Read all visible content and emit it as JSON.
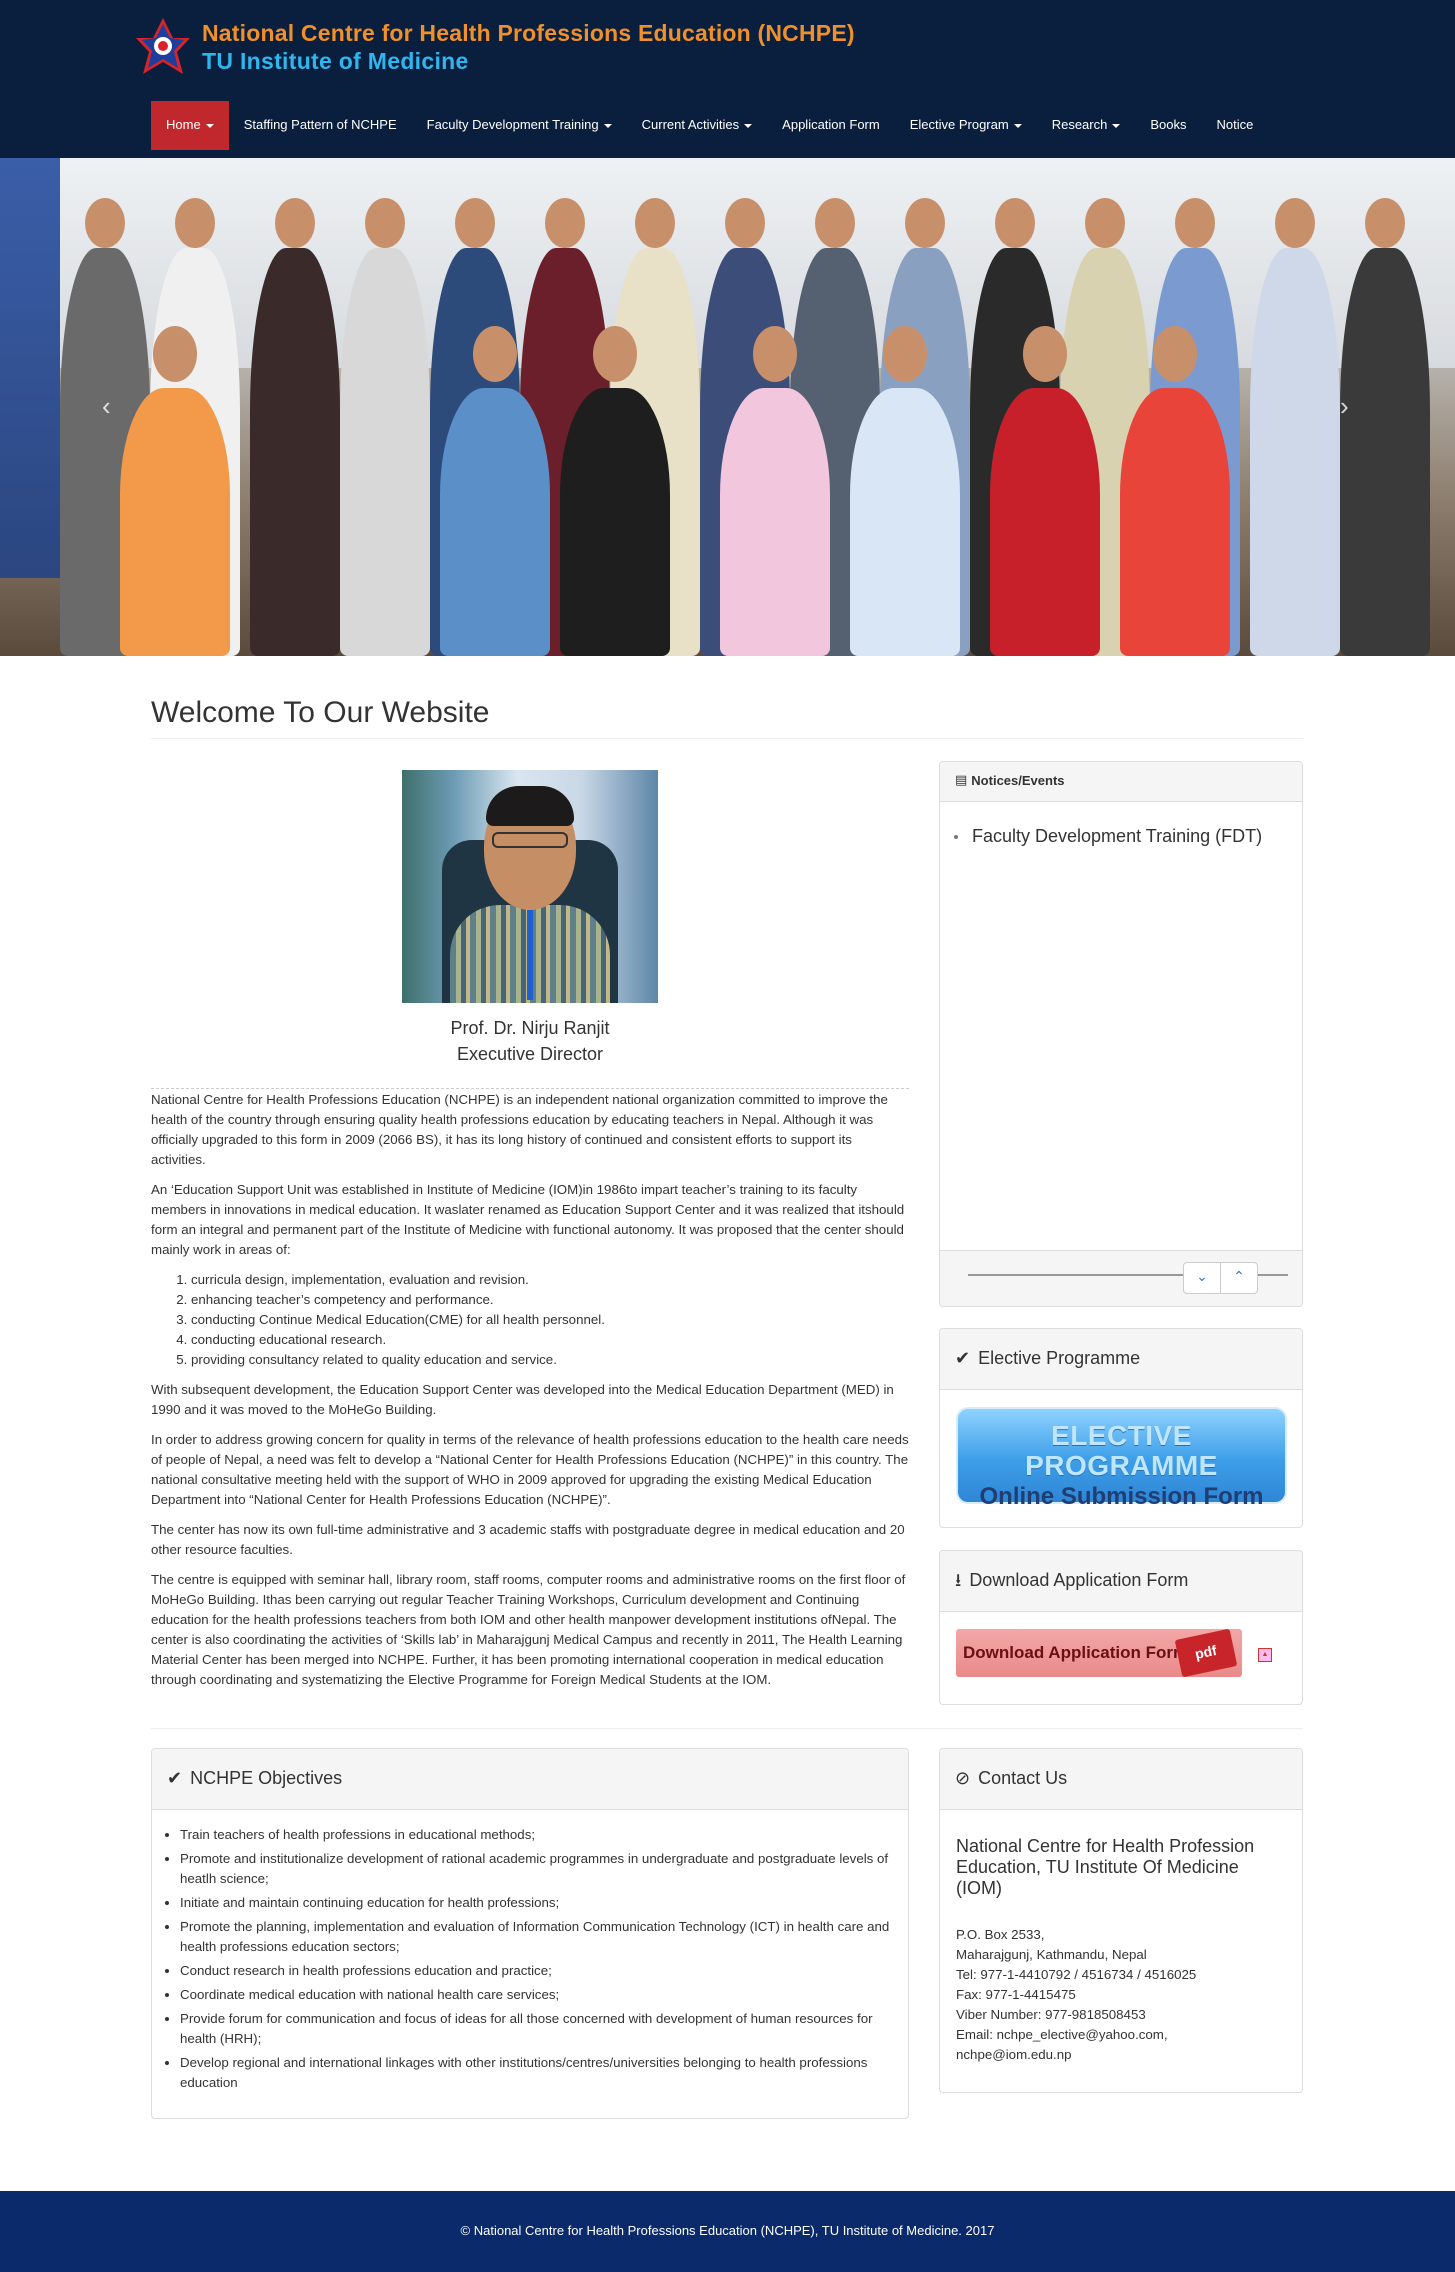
{
  "header": {
    "title_line1": "National Centre for Health Professions Education (NCHPE)",
    "title_line2": "TU Institute of Medicine",
    "logo_icon": "star-emblem-icon",
    "colors": {
      "background": "#0a1f3d",
      "title1": "#f0902a",
      "title2": "#2fb6ee",
      "active_nav": "#c0282d"
    }
  },
  "nav": {
    "items": [
      {
        "label": "Home",
        "dropdown": true,
        "active": true
      },
      {
        "label": "Staffing Pattern of NCHPE",
        "dropdown": false
      },
      {
        "label": "Faculty Development Training",
        "dropdown": true
      },
      {
        "label": "Current Activities",
        "dropdown": true
      },
      {
        "label": "Application Form",
        "dropdown": false
      },
      {
        "label": "Elective Program",
        "dropdown": true
      },
      {
        "label": "Research",
        "dropdown": true
      },
      {
        "label": "Books",
        "dropdown": false
      },
      {
        "label": "Notice",
        "dropdown": false
      }
    ]
  },
  "carousel": {
    "prev": "‹",
    "next": "›"
  },
  "welcome": {
    "heading": "Welcome To Our Website"
  },
  "director": {
    "name": "Prof. Dr. Nirju Ranjit",
    "title": "Executive Director"
  },
  "about": {
    "p1": "National Centre for Health Professions Education (NCHPE) is an independent national organization committed to improve the health of the country through ensuring quality health professions education by educating teachers in Nepal. Although it was officially upgraded to this form in 2009 (2066 BS), it has its long history of continued and consistent efforts to support its activities.",
    "p2": "An ‘Education Support Unit was established in Institute of Medicine (IOM)in 1986to impart teacher’s training to its faculty members in innovations in medical education. It waslater renamed as Education Support Center and it was realized that itshould form an integral and permanent part of the Institute of Medicine with functional autonomy. It was proposed that the center should mainly work in areas of:",
    "areas": [
      "curricula design, implementation, evaluation and revision.",
      "enhancing teacher’s competency and performance.",
      "conducting Continue Medical Education(CME) for all health personnel.",
      "conducting educational research.",
      "providing consultancy related to quality education and service."
    ],
    "p3": "With subsequent development, the Education Support Center was developed into the Medical Education Department (MED) in 1990 and it was moved to the MoHeGo Building.",
    "p4": "In order to address growing concern for quality in terms of the relevance of health professions education to the health care needs of people of Nepal, a need was felt to develop a “National Center for Health Professions Education (NCHPE)” in this country. The national consultative meeting held with the support of WHO in 2009 approved for upgrading the existing Medical Education Department into “National Center for Health Professions Education (NCHPE)”.",
    "p5": "The center has now its own full-time  administrative and 3 academic staffs with postgraduate degree in medical education and 20 other resource faculties.",
    "p6": "The centre is equipped with seminar hall, library room, staff rooms, computer rooms and administrative rooms on the first floor of MoHeGo Building. Ithas been carrying out regular Teacher Training Workshops, Curriculum development and Continuing education for the health professions teachers from both IOM and other health manpower development institutions ofNepal. The center is also coordinating the activities of ‘Skills lab’ in Maharajgunj Medical Campus and recently in 2011, The Health Learning Material Center has been merged into NCHPE. Further, it has been promoting international cooperation in medical education through coordinating and systematizing the Elective Programme for Foreign Medical Students at the IOM."
  },
  "notices": {
    "heading": "Notices/Events",
    "items": [
      "Faculty Development Training (FDT)"
    ]
  },
  "elective": {
    "heading": "Elective Programme",
    "banner_line1": "ELECTIVE PROGRAMME",
    "banner_line2": "Online Submission Form"
  },
  "download": {
    "heading": "Download Application Form",
    "button_text": "Download Application Form",
    "pdf_label": "pdf"
  },
  "objectives": {
    "heading": "NCHPE Objectives",
    "items": [
      "Train teachers of health professions in educational methods;",
      "Promote and institutionalize development of rational academic programmes in undergraduate and postgraduate levels of heatlh science;",
      "Initiate and maintain continuing education for health professions;",
      "Promote the planning, implementation and evaluation of Information Communication Technology (ICT) in health care and health professions education sectors;",
      "Conduct research in health professions education and practice;",
      "Coordinate medical education with national health care services;",
      "Provide forum for communication and focus of ideas for all those concerned with development of human resources for health (HRH);",
      "Develop regional and international linkages with other institutions/centres/universities belonging to health professions education"
    ]
  },
  "contact": {
    "heading": "Contact Us",
    "org": "National Centre for Health Profession Education, TU Institute Of Medicine (IOM)",
    "lines": [
      "P.O. Box 2533,",
      "Maharajgunj, Kathmandu, Nepal",
      "Tel: 977-1-4410792 / 4516734 / 4516025",
      "Fax: 977-1-4415475",
      "Viber Number: 977-9818508453",
      "Email: nchpe_elective@yahoo.com,",
      "nchpe@iom.edu.np"
    ]
  },
  "footer": {
    "text": "© National Centre for Health Professions Education (NCHPE), TU Institute of Medicine. 2017"
  }
}
